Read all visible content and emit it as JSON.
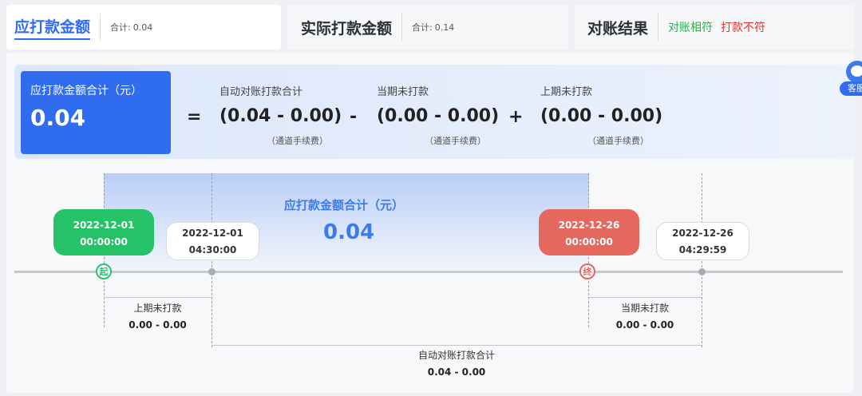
{
  "tabs": [
    {
      "title": "应打款金额",
      "sum_label": "合计:",
      "sum_value": "0.04",
      "active": true
    },
    {
      "title": "实际打款金额",
      "sum_label": "合计:",
      "sum_value": "0.14",
      "active": false
    },
    {
      "title": "对账结果",
      "status_ok": "对账相符",
      "status_bad": "打款不符",
      "active": false
    }
  ],
  "formula": {
    "total_label": "应打款金额合计（元）",
    "total_value": "0.04",
    "eq": "=",
    "minus": "-",
    "plus": "+",
    "terms": [
      {
        "label": "自动对账打款合计",
        "value": "(0.04 - 0.00)",
        "note": "（通道手续费）"
      },
      {
        "label": "当期未打款",
        "value": "(0.00 - 0.00)",
        "note": "（通道手续费）"
      },
      {
        "label": "上期未打款",
        "value": "(0.00 - 0.00)",
        "note": "（通道手续费）"
      }
    ]
  },
  "timeline": {
    "shade_label": "应打款金额合计（元）",
    "shade_value": "0.04",
    "start_marker": "起",
    "end_marker": "终",
    "bubbles": [
      {
        "date": "2022-12-01",
        "time": "00:00:00",
        "color": "#25c267"
      },
      {
        "date": "2022-12-01",
        "time": "04:30:00",
        "color": "#ffffff"
      },
      {
        "date": "2022-12-26",
        "time": "00:00:00",
        "color": "#e5685f"
      },
      {
        "date": "2022-12-26",
        "time": "04:29:59",
        "color": "#ffffff"
      }
    ],
    "dimensions": [
      {
        "label": "上期未打款",
        "value": "0.00 - 0.00"
      },
      {
        "label": "当期未打款",
        "value": "0.00 - 0.00"
      },
      {
        "label": "自动对账打款合计",
        "value": "0.04 - 0.00"
      }
    ]
  },
  "service": {
    "label": "客服",
    "icon": "customer-service-icon"
  },
  "colors": {
    "accent": "#2f6cf0",
    "ok": "#2dac4f",
    "bad": "#e5312f",
    "start": "#25c267",
    "end": "#e5685f"
  }
}
